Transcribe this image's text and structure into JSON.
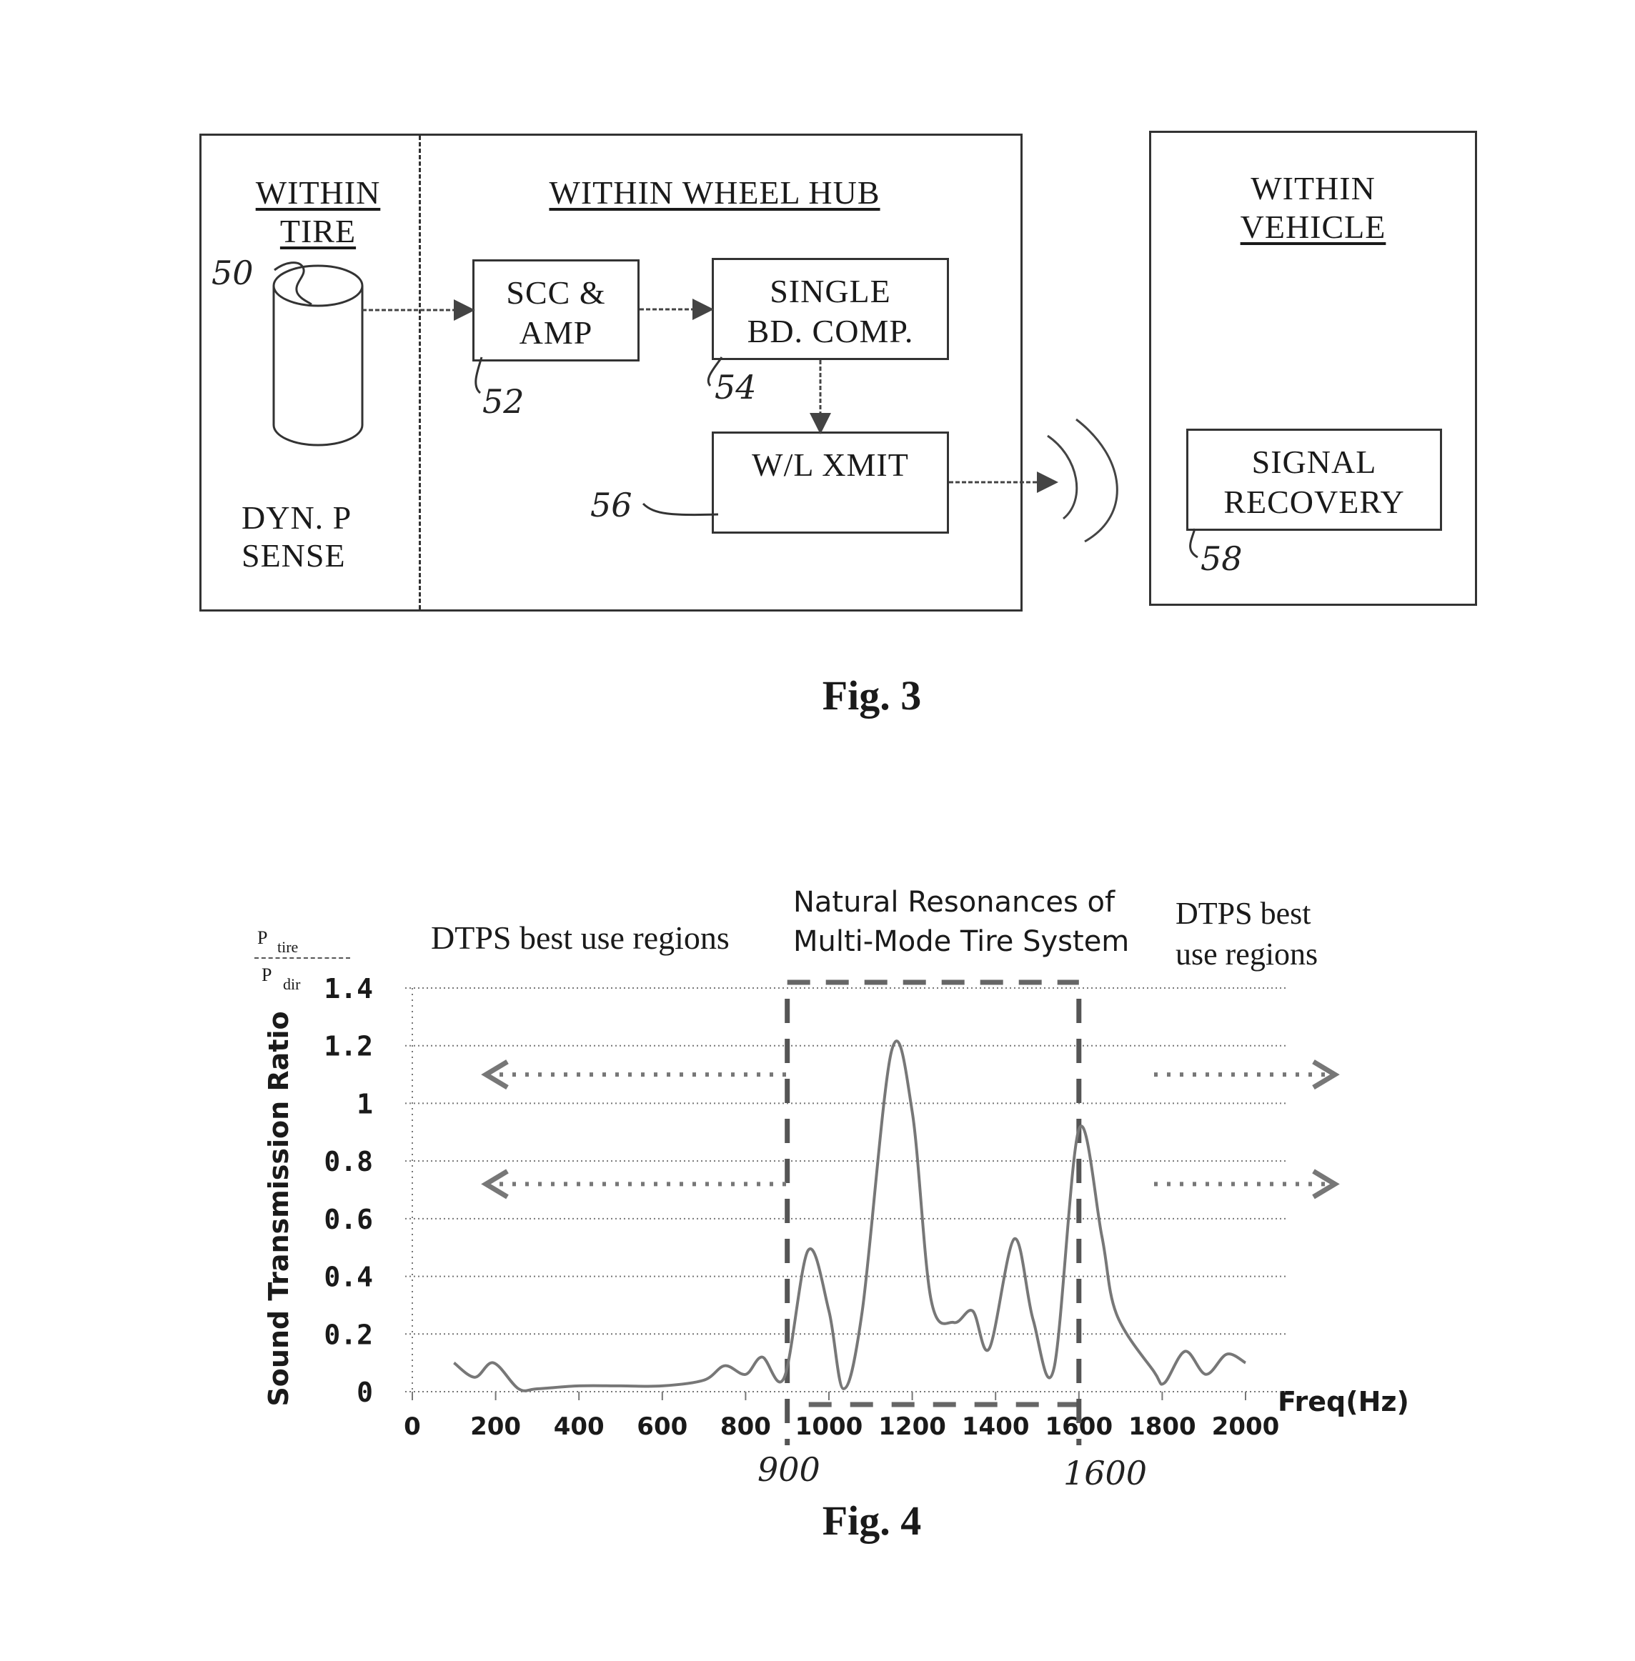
{
  "fig3": {
    "caption": "Fig. 3",
    "tire_zone": {
      "title_line1": "WITHIN",
      "title_line2": "TIRE",
      "sensor_label_line1": "DYN. P",
      "sensor_label_line2": "SENSE",
      "ref": "50"
    },
    "hub_zone": {
      "title": "WITHIN WHEEL HUB"
    },
    "blocks": [
      {
        "id": "scc_amp",
        "line1": "SCC &",
        "line2": "AMP",
        "ref": "52"
      },
      {
        "id": "single_bd_comp",
        "line1": "SINGLE",
        "line2": "BD. COMP.",
        "ref": "54"
      },
      {
        "id": "wl_xmit",
        "line1": "W/L XMIT",
        "line2": "",
        "ref": "56"
      },
      {
        "id": "signal_recovery",
        "line1": "SIGNAL",
        "line2": "RECOVERY",
        "ref": "58"
      }
    ],
    "vehicle_zone": {
      "title_line1": "WITHIN",
      "title_line2": "VEHICLE"
    },
    "wireless_icon": "radio-waves-icon"
  },
  "fig4": {
    "caption": "Fig. 4",
    "ratio_label": {
      "numerator": "P",
      "numerator_sub": "tire",
      "denominator": "P",
      "denominator_sub": "dir"
    },
    "annotations": {
      "left_region": "DTPS best use regions",
      "middle_line1": "Natural Resonances of",
      "middle_line2": "Multi-Mode Tire System",
      "right_line1": "DTPS best",
      "right_line2": "use regions",
      "marker_low": "900",
      "marker_high": "1600"
    }
  },
  "chart_data": {
    "type": "line",
    "title": "",
    "xlabel": "Freq(Hz)",
    "ylabel": "Sound Transmission Ratio",
    "xlim": [
      0,
      2000
    ],
    "ylim": [
      0,
      1.4
    ],
    "xticks": [
      0,
      200,
      400,
      600,
      800,
      1000,
      1200,
      1400,
      1600,
      1800,
      2000
    ],
    "xtick_labels": [
      "0",
      "200",
      "400",
      "600",
      "800",
      "1000",
      "1200",
      "1400",
      "1600",
      "1800",
      "2000"
    ],
    "yticks": [
      0,
      0.2,
      0.4,
      0.6,
      0.8,
      1,
      1.2,
      1.4
    ],
    "ytick_labels": [
      "0",
      "0.2",
      "0.4",
      "0.6",
      "0.8",
      "1",
      "1.2",
      "1.4"
    ],
    "grid": true,
    "series": [
      {
        "name": "Sound Transmission Ratio",
        "x": [
          100,
          150,
          195,
          255,
          300,
          400,
          500,
          600,
          700,
          750,
          800,
          840,
          893,
          950,
          1000,
          1035,
          1080,
          1150,
          1200,
          1245,
          1300,
          1345,
          1385,
          1445,
          1490,
          1540,
          1600,
          1655,
          1690,
          1780,
          1805,
          1855,
          1905,
          1955,
          2000
        ],
        "y": [
          0.1,
          0.05,
          0.1,
          0.01,
          0.01,
          0.02,
          0.02,
          0.02,
          0.04,
          0.09,
          0.06,
          0.12,
          0.05,
          0.49,
          0.28,
          0.01,
          0.28,
          1.18,
          0.97,
          0.32,
          0.24,
          0.28,
          0.15,
          0.53,
          0.25,
          0.08,
          0.91,
          0.54,
          0.27,
          0.07,
          0.03,
          0.14,
          0.06,
          0.13,
          0.1
        ]
      }
    ],
    "vertical_markers": [
      900,
      1600
    ],
    "horizontal_marker_y": 1.4,
    "region_arrows": [
      {
        "direction": "left",
        "from_x": 900,
        "to_x": 200,
        "y": 1.1
      },
      {
        "direction": "left",
        "from_x": 900,
        "to_x": 200,
        "y": 0.72
      },
      {
        "direction": "right",
        "from_x": 1650,
        "to_x": 2230,
        "y": 1.1
      },
      {
        "direction": "right",
        "from_x": 1650,
        "to_x": 2230,
        "y": 0.72
      }
    ]
  }
}
